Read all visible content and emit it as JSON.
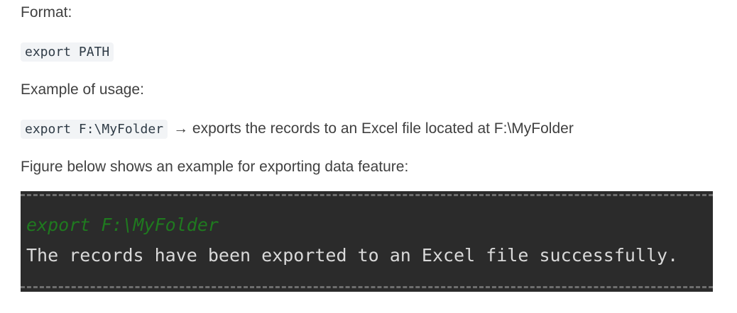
{
  "doc": {
    "format_heading": "Format:",
    "format_code": "export PATH",
    "usage_heading": "Example of usage:",
    "usage_code": "export F:\\MyFolder",
    "usage_description": "→ exports the records to an Excel file located at F:\\MyFolder",
    "figure_intro": "Figure below shows an example for exporting data feature:"
  },
  "terminal": {
    "command": "export F:\\MyFolder",
    "output": "The records have been exported to an Excel file successfully.",
    "background_color": "#2b2b2b",
    "command_color": "#1f7a1f",
    "output_color": "#d9d9d9"
  }
}
